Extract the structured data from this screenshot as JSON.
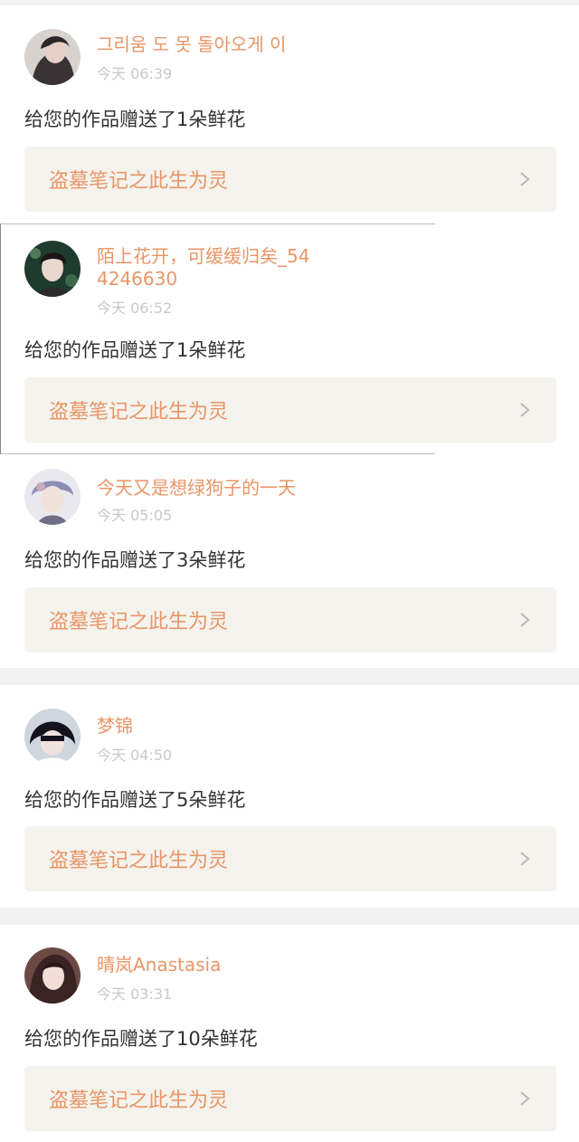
{
  "feed": [
    {
      "name": "그리움 도 못 돌아오게 이",
      "time": "今天 06:39",
      "message": "给您的作品赠送了1朵鲜花",
      "work_title": "盗墓笔记之此生为灵",
      "icons": {
        "avatar": "user-avatar",
        "chevron": "chevron-right-icon"
      }
    },
    {
      "name": "陌上花开，可缓缓归矣_544246630",
      "time": "今天 06:52",
      "message": "给您的作品赠送了1朵鲜花",
      "work_title": "盗墓笔记之此生为灵",
      "icons": {
        "avatar": "user-avatar",
        "chevron": "chevron-right-icon"
      }
    },
    {
      "name": "今天又是想绿狗子的一天",
      "time": "今天 05:05",
      "message": "给您的作品赠送了3朵鲜花",
      "work_title": "盗墓笔记之此生为灵",
      "icons": {
        "avatar": "user-avatar",
        "chevron": "chevron-right-icon"
      }
    },
    {
      "name": "梦锦",
      "time": "今天 04:50",
      "message": "给您的作品赠送了5朵鲜花",
      "work_title": "盗墓笔记之此生为灵",
      "icons": {
        "avatar": "user-avatar",
        "chevron": "chevron-right-icon"
      }
    },
    {
      "name": "晴岚Anastasia",
      "time": "今天 03:31",
      "message": "给您的作品赠送了10朵鲜花",
      "work_title": "盗墓笔记之此生为灵",
      "icons": {
        "avatar": "user-avatar",
        "chevron": "chevron-right-icon"
      }
    }
  ],
  "colors": {
    "accent": "#e99566",
    "timestamp": "#c8c8c8",
    "work_bg": "#f4f3ee",
    "page_bg": "#f2f2f2"
  }
}
